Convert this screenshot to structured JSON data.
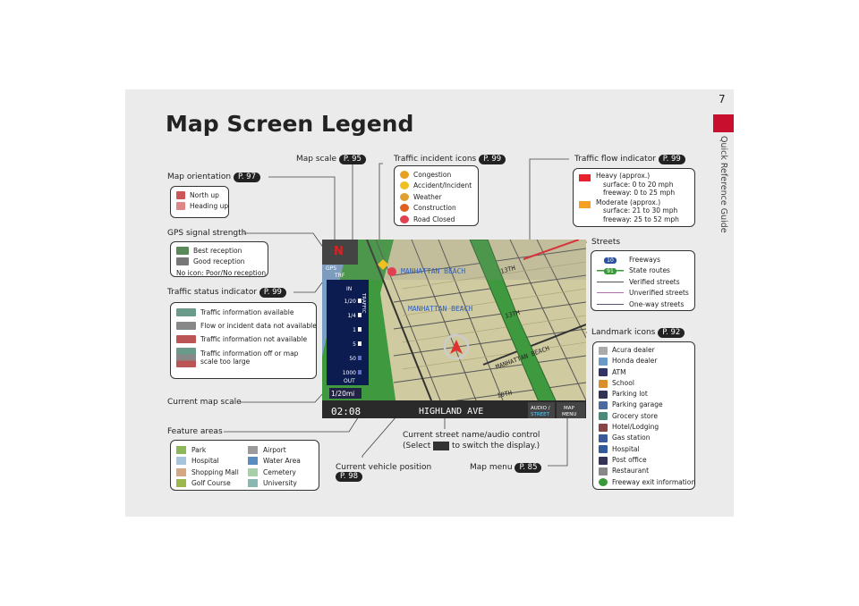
{
  "page": {
    "number": "7",
    "side_label": "Quick Reference Guide",
    "title": "Map Screen Legend",
    "accent": "#c8102e"
  },
  "callouts": {
    "map_scale": {
      "label": "Map scale",
      "ref": "P. 95"
    },
    "traffic_incident": {
      "label": "Traffic incident icons",
      "ref": "P. 99"
    },
    "traffic_flow": {
      "label": "Traffic flow indicator",
      "ref": "P. 99"
    },
    "map_orientation": {
      "label": "Map orientation",
      "ref": "P. 97"
    },
    "gps": {
      "label": "GPS signal strength"
    },
    "traffic_status": {
      "label": "Traffic status indicator",
      "ref": "P. 99"
    },
    "current_map_scale": {
      "label": "Current map scale"
    },
    "feature_areas": {
      "label": "Feature areas"
    },
    "streets": {
      "label": "Streets"
    },
    "landmark": {
      "label": "Landmark icons",
      "ref": "P. 92"
    },
    "vehicle": {
      "label": "Current vehicle position",
      "ref": "P. 98"
    },
    "street_name": {
      "line1": "Current street name/audio control",
      "line2a": "(Select",
      "line2b": "to switch the display.)"
    },
    "map_menu": {
      "label": "Map menu",
      "ref": "P. 85"
    }
  },
  "orientation": [
    "North up",
    "Heading up"
  ],
  "gps_items": [
    "Best reception",
    "Good reception",
    "No icon: Poor/No reception"
  ],
  "traffic_status_items": [
    "Traffic information available",
    "Flow or incident data not available",
    "Traffic information not available",
    "Traffic information off or map scale too large"
  ],
  "incidents": [
    {
      "label": "Congestion",
      "color": "#e8a020"
    },
    {
      "label": "Accident/Incident",
      "color": "#f0c020"
    },
    {
      "label": "Weather",
      "color": "#e0a030"
    },
    {
      "label": "Construction",
      "color": "#e06020"
    },
    {
      "label": "Road Closed",
      "color": "#e04050"
    }
  ],
  "flow": {
    "heavy": {
      "title": "Heavy (approx.)",
      "l1": "surface: 0 to 20 mph",
      "l2": "freeway: 0 to 25 mph",
      "color": "#e8202a"
    },
    "moderate": {
      "title": "Moderate (approx.)",
      "l1": "surface: 21 to 30 mph",
      "l2": "freeway: 25 to 52 mph",
      "color": "#f5a020"
    }
  },
  "streets_items": [
    {
      "label": "Freeways",
      "shield": "10"
    },
    {
      "label": "State routes",
      "shield": "91"
    },
    {
      "label": "Verified streets"
    },
    {
      "label": "Unverified streets"
    },
    {
      "label": "One-way streets"
    }
  ],
  "landmarks": [
    "Acura dealer",
    "Honda dealer",
    "ATM",
    "School",
    "Parking lot",
    "Parking garage",
    "Grocery store",
    "Hotel/Lodging",
    "Gas station",
    "Hospital",
    "Post office",
    "Restaurant",
    "Freeway exit information"
  ],
  "features": [
    {
      "label": "Park",
      "color": "#8db85a"
    },
    {
      "label": "Airport",
      "color": "#9a9a9a"
    },
    {
      "label": "Hospital",
      "color": "#a6c4dc"
    },
    {
      "label": "Water Area",
      "color": "#5a8cc0"
    },
    {
      "label": "Shopping Mall",
      "color": "#d4a882"
    },
    {
      "label": "Cemetery",
      "color": "#a8d0a8"
    },
    {
      "label": "Golf Course",
      "color": "#9cb84c"
    },
    {
      "label": "University",
      "color": "#88b8b0"
    }
  ],
  "map": {
    "streets": [
      "MANHATTAN BEACH",
      "MANHATTAN BEACH",
      "MANHATTAN BEACH",
      "13TH",
      "13TH",
      "10TH"
    ],
    "scale_in": "IN",
    "scale_out": "OUT",
    "scales": [
      "1/20",
      "1/4",
      "1",
      "5",
      "50",
      "1000"
    ],
    "traffic": "TRAFFIC",
    "current_scale": "1/20mi",
    "clock": "02:08",
    "street": "HIGHLAND AVE",
    "audio": "AUDIO /",
    "audio2": "STREET",
    "menu": "MAP",
    "menu2": "MENU",
    "north": "N",
    "gps": "GPS",
    "trf": "TRF"
  }
}
